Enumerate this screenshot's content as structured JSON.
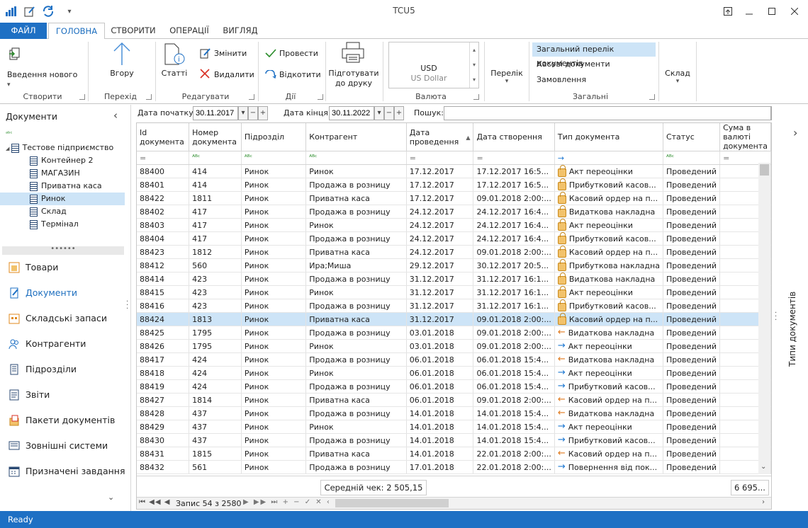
{
  "window": {
    "title": "TCU5"
  },
  "ribbon_tabs": [
    "ФАЙЛ",
    "ГОЛОВНА",
    "СТВОРИТИ",
    "ОПЕРАЦІЇ",
    "ВИГЛЯД"
  ],
  "ribbon": {
    "create": {
      "btn": "Введення нового",
      "group": "Створити"
    },
    "nav": {
      "btn": "Вгору",
      "group": "Перехід"
    },
    "edit": {
      "articles": "Статті",
      "change": "Змінити",
      "delete": "Видалити",
      "group": "Редагувати"
    },
    "actions": {
      "post": "Провести",
      "unpost": "Відкотити",
      "group": "Дії"
    },
    "print": {
      "line1": "Підготувати",
      "line2": "до друку"
    },
    "currency": {
      "code": "USD",
      "name": "US Dollar",
      "group": "Валюта"
    },
    "list": {
      "btn": "Перелік"
    },
    "general": {
      "all": "Загальний перелік документів",
      "cash": "Касові документи",
      "orders": "Замовлення",
      "group": "Загальні"
    },
    "warehouse": {
      "btn": "Склад"
    }
  },
  "sidebar": {
    "title": "Документи",
    "tree": [
      {
        "label": "Тестове підприємство",
        "level": 0
      },
      {
        "label": "Контейнер 2",
        "level": 1
      },
      {
        "label": "МАГАЗИН",
        "level": 1
      },
      {
        "label": "Приватна каса",
        "level": 1
      },
      {
        "label": "Ринок",
        "level": 1,
        "selected": true
      },
      {
        "label": "Склад",
        "level": 1
      },
      {
        "label": "Термінал",
        "level": 1
      }
    ],
    "nav": [
      {
        "label": "Товари",
        "icon": "box-icon"
      },
      {
        "label": "Документи",
        "icon": "documents-icon",
        "active": true
      },
      {
        "label": "Складські запаси",
        "icon": "warehouse-icon"
      },
      {
        "label": "Контрагенти",
        "icon": "people-icon"
      },
      {
        "label": "Підрозділи",
        "icon": "building-icon"
      },
      {
        "label": "Звіти",
        "icon": "report-icon"
      },
      {
        "label": "Пакети документів",
        "icon": "package-icon"
      },
      {
        "label": "Зовнішні системи",
        "icon": "external-icon"
      },
      {
        "label": "Призначені завдання",
        "icon": "calendar-icon"
      }
    ]
  },
  "filter": {
    "start_label": "Дата початку:",
    "start": "30.11.2017",
    "end_label": "Дата кінця:",
    "end": "30.11.2022",
    "search_label": "Пошук:",
    "search": ""
  },
  "grid": {
    "columns": [
      "Id документа",
      "Номер документа",
      "Підрозділ",
      "Контрагент",
      "Дата проведення",
      "Дата створення",
      "Тип документа",
      "Статус",
      "Сума в валюті документа"
    ],
    "rows": [
      [
        "88400",
        "414",
        "Ринок",
        "Ринок",
        "17.12.2017",
        "17.12.2017 16:5...",
        "Акт переоцінки",
        "Проведений",
        "lock"
      ],
      [
        "88401",
        "414",
        "Ринок",
        "Продажа в розницу",
        "17.12.2017",
        "17.12.2017 16:5...",
        "Прибутковий касов...",
        "Проведений",
        "lock"
      ],
      [
        "88422",
        "1811",
        "Ринок",
        "Приватна каса",
        "17.12.2017",
        "09.01.2018 2:00:...",
        "Касовий ордер на п...",
        "Проведений",
        "lock"
      ],
      [
        "88402",
        "417",
        "Ринок",
        "Продажа в розницу",
        "24.12.2017",
        "24.12.2017 16:4...",
        "Видаткова накладна",
        "Проведений",
        "lock"
      ],
      [
        "88403",
        "417",
        "Ринок",
        "Ринок",
        "24.12.2017",
        "24.12.2017 16:4...",
        "Акт переоцінки",
        "Проведений",
        "lock"
      ],
      [
        "88404",
        "417",
        "Ринок",
        "Продажа в розницу",
        "24.12.2017",
        "24.12.2017 16:4...",
        "Прибутковий касов...",
        "Проведений",
        "lock"
      ],
      [
        "88423",
        "1812",
        "Ринок",
        "Приватна каса",
        "24.12.2017",
        "09.01.2018 2:00:...",
        "Касовий ордер на п...",
        "Проведений",
        "lock"
      ],
      [
        "88412",
        "560",
        "Ринок",
        "Ира;Миша",
        "29.12.2017",
        "30.12.2017 20:5...",
        "Прибуткова накладна",
        "Проведений",
        "lock"
      ],
      [
        "88414",
        "423",
        "Ринок",
        "Продажа в розницу",
        "31.12.2017",
        "31.12.2017 16:1...",
        "Видаткова накладна",
        "Проведений",
        "lock"
      ],
      [
        "88415",
        "423",
        "Ринок",
        "Ринок",
        "31.12.2017",
        "31.12.2017 16:1...",
        "Акт переоцінки",
        "Проведений",
        "lock"
      ],
      [
        "88416",
        "423",
        "Ринок",
        "Продажа в розницу",
        "31.12.2017",
        "31.12.2017 16:1...",
        "Прибутковий касов...",
        "Проведений",
        "lock"
      ],
      [
        "88424",
        "1813",
        "Ринок",
        "Приватна каса",
        "31.12.2017",
        "09.01.2018 2:00:...",
        "Касовий ордер на п...",
        "Проведений",
        "lock"
      ],
      [
        "88425",
        "1795",
        "Ринок",
        "Продажа в розницу",
        "03.01.2018",
        "09.01.2018 2:00:...",
        "Видаткова накладна",
        "Проведений",
        "out"
      ],
      [
        "88426",
        "1795",
        "Ринок",
        "Ринок",
        "03.01.2018",
        "09.01.2018 2:00:...",
        "Акт переоцінки",
        "Проведений",
        "in"
      ],
      [
        "88417",
        "424",
        "Ринок",
        "Продажа в розницу",
        "06.01.2018",
        "06.01.2018 15:4...",
        "Видаткова накладна",
        "Проведений",
        "out"
      ],
      [
        "88418",
        "424",
        "Ринок",
        "Ринок",
        "06.01.2018",
        "06.01.2018 15:4...",
        "Акт переоцінки",
        "Проведений",
        "in"
      ],
      [
        "88419",
        "424",
        "Ринок",
        "Продажа в розницу",
        "06.01.2018",
        "06.01.2018 15:4...",
        "Прибутковий касов...",
        "Проведений",
        "in"
      ],
      [
        "88427",
        "1814",
        "Ринок",
        "Приватна каса",
        "06.01.2018",
        "09.01.2018 2:00:...",
        "Касовий ордер на п...",
        "Проведений",
        "out"
      ],
      [
        "88428",
        "437",
        "Ринок",
        "Продажа в розницу",
        "14.01.2018",
        "14.01.2018 15:4...",
        "Видаткова накладна",
        "Проведений",
        "out"
      ],
      [
        "88429",
        "437",
        "Ринок",
        "Ринок",
        "14.01.2018",
        "14.01.2018 15:4...",
        "Акт переоцінки",
        "Проведений",
        "in"
      ],
      [
        "88430",
        "437",
        "Ринок",
        "Продажа в розницу",
        "14.01.2018",
        "14.01.2018 15:4...",
        "Прибутковий касов...",
        "Проведений",
        "in"
      ],
      [
        "88431",
        "1815",
        "Ринок",
        "Приватна каса",
        "14.01.2018",
        "22.01.2018 2:00:...",
        "Касовий ордер на п...",
        "Проведений",
        "out"
      ],
      [
        "88432",
        "561",
        "Ринок",
        "Продажа в розницу",
        "17.01.2018",
        "22.01.2018 2:00:...",
        "Повернення від пок...",
        "Проведений",
        "in"
      ]
    ],
    "selected_index": 11,
    "avg_check": "Середній чек: 2 505,15",
    "sum_total": "6 695...",
    "record": "Запис 54 з 2580"
  },
  "right_panel": {
    "label": "Типи документів"
  },
  "status": "Ready"
}
